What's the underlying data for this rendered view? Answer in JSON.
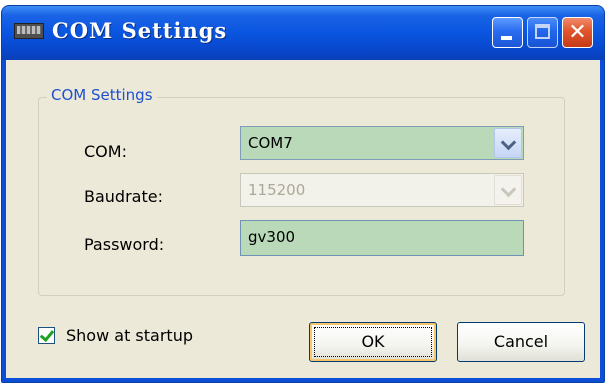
{
  "window": {
    "title": "COM Settings",
    "icon": "serial-port-icon"
  },
  "group": {
    "legend": "COM Settings"
  },
  "form": {
    "com_label": "COM:",
    "com_value": "COM7",
    "baudrate_label": "Baudrate:",
    "baudrate_value": "115200",
    "baudrate_enabled": false,
    "password_label": "Password:",
    "password_value": "gv300"
  },
  "footer": {
    "show_at_startup_label": "Show at startup",
    "show_at_startup_checked": true,
    "ok_label": "OK",
    "cancel_label": "Cancel"
  },
  "colors": {
    "titlebar": "#0a55e0",
    "client_bg": "#ece9d8",
    "field_highlight": "#b9d9b9",
    "legend_text": "#1d4fd0",
    "close_button": "#e0552c"
  }
}
